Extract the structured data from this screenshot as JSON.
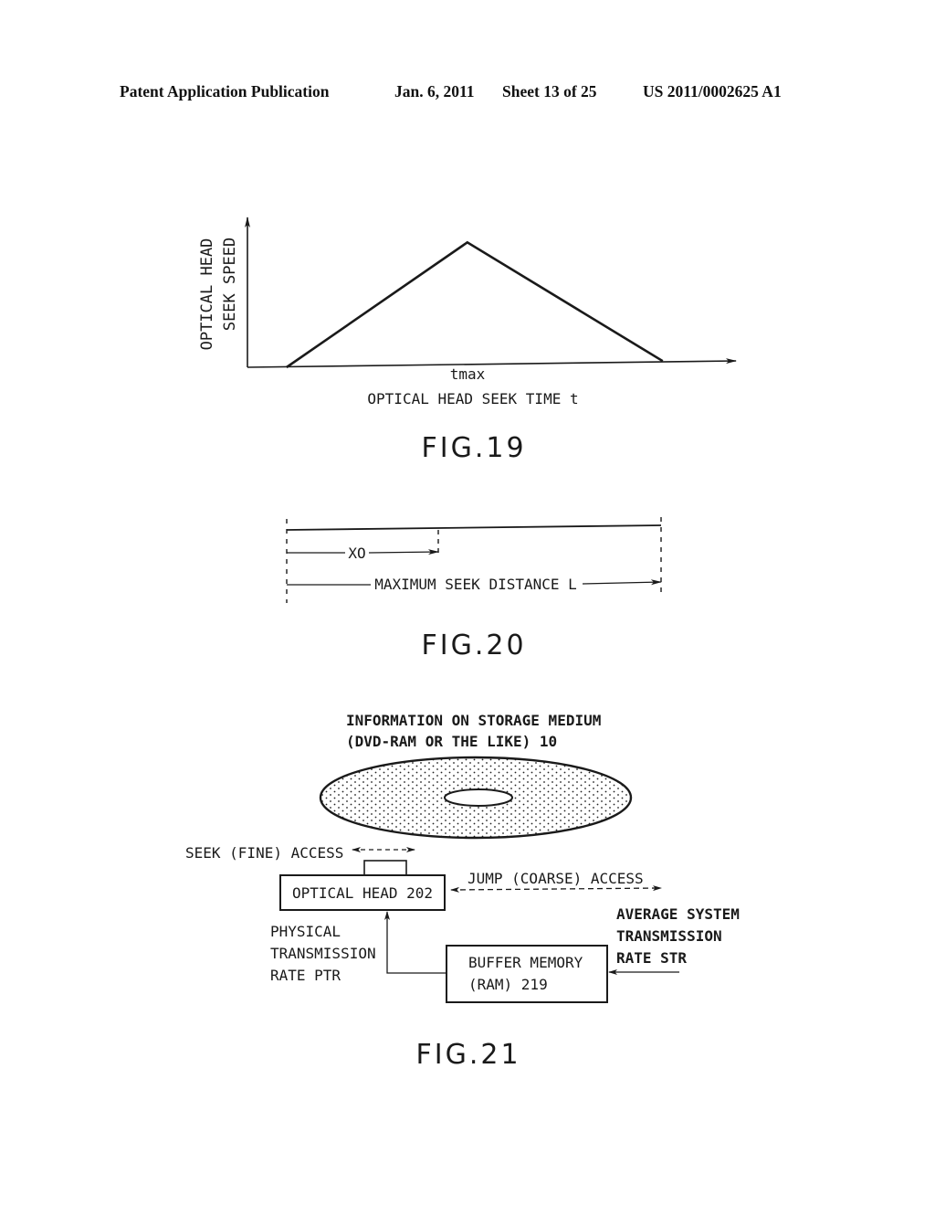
{
  "header": {
    "publication": "Patent Application Publication",
    "date": "Jan. 6, 2011",
    "sheet": "Sheet 13 of 25",
    "number": "US 2011/0002625 A1"
  },
  "fig19": {
    "ylabel_line1": "OPTICAL HEAD",
    "ylabel_line2": "SEEK SPEED",
    "peak_label": "tmax",
    "xlabel": "OPTICAL HEAD SEEK TIME t",
    "caption": "FIG.19",
    "chart_data": {
      "type": "line",
      "title": "",
      "xlabel": "OPTICAL HEAD SEEK TIME t",
      "ylabel": "OPTICAL HEAD SEEK SPEED",
      "x_tick_labels": [
        "tmax"
      ],
      "series": [
        {
          "name": "seek speed profile",
          "x": [
            0.08,
            0.45,
            0.85
          ],
          "y": [
            0,
            1,
            0.05
          ]
        }
      ],
      "xlim": [
        0,
        1
      ],
      "ylim": [
        0,
        1.2
      ],
      "grid": false,
      "note": "Triangular profile: speed rises linearly to peak at tmax, then decreases linearly"
    }
  },
  "fig20": {
    "x0_label": "XO",
    "max_label": "MAXIMUM SEEK DISTANCE L",
    "caption": "FIG.20"
  },
  "fig21": {
    "medium_label_line1": "INFORMATION ON STORAGE MEDIUM",
    "medium_label_line2": "(DVD-RAM OR THE LIKE) 10",
    "seek_label": "SEEK (FINE) ACCESS",
    "optical_head": "OPTICAL HEAD 202",
    "jump_label": "JUMP (COARSE) ACCESS",
    "ptr_line1": "PHYSICAL",
    "ptr_line2": "TRANSMISSION",
    "ptr_line3": "RATE PTR",
    "buffer_line1": "BUFFER MEMORY",
    "buffer_line2": "(RAM) 219",
    "str_line1": "AVERAGE SYSTEM",
    "str_line2": "TRANSMISSION",
    "str_line3": "RATE STR",
    "caption": "FIG.21"
  }
}
